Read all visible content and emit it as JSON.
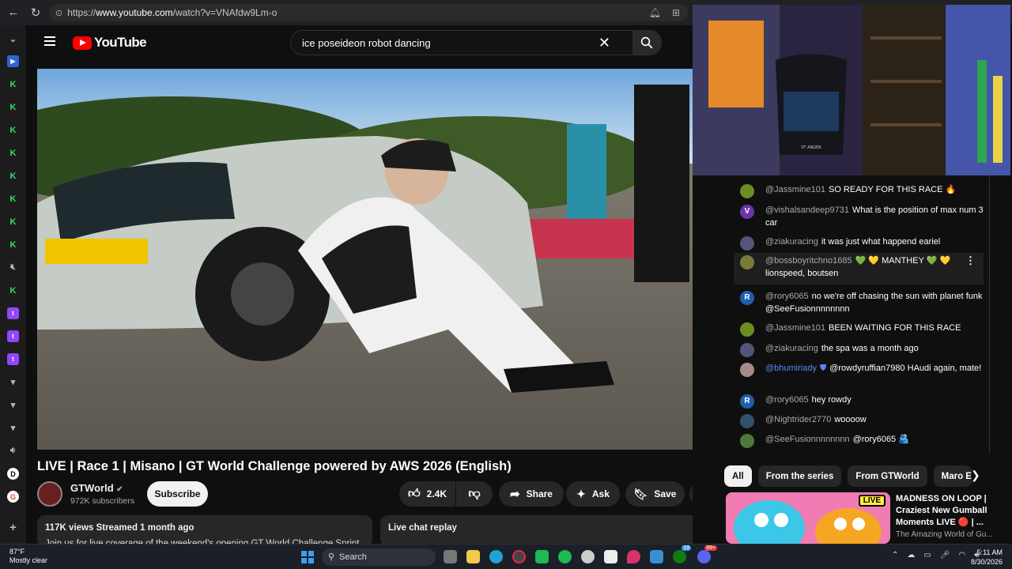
{
  "browser": {
    "url_prefix": "https://",
    "url_host": "www.youtube.com",
    "url_path": "/watch?v=VNAfdw9Lm-o"
  },
  "header": {
    "logo": "YouTube",
    "search_value": "ice poseideon robot dancing"
  },
  "video": {
    "title": "LIVE | Race 1 | Misano | GT World Challenge powered by AWS 2026 (English)",
    "channel": "GTWorld",
    "subscribers": "972K subscribers",
    "subscribe_label": "Subscribe",
    "likes": "2.4K",
    "share_label": "Share",
    "ask_label": "Ask",
    "save_label": "Save"
  },
  "description": {
    "stats": "117K views  Streamed 1 month ago",
    "snippet": "Join us for live coverage of the weekend's opening GT World Challenge Sprint"
  },
  "chat_replay_label": "Live chat replay",
  "chat": [
    {
      "user": "@Jassmine101",
      "text": "SO READY FOR THIS RACE 🔥",
      "avatar_color": "#6b8e23",
      "initial": ""
    },
    {
      "user": "@vishalsandeep9731",
      "text": "What is the position of max num 3 car",
      "avatar_color": "#6b35a8",
      "initial": "V"
    },
    {
      "user": "@ziakuracing",
      "text": "it was just what happend eariel",
      "avatar_color": "#55557a",
      "initial": ""
    },
    {
      "user": "@bossboyritchno1685",
      "text": "💚 💛 MANTHEY 💚 💛 lionspeed, boutsen",
      "avatar_color": "#7a7a3a",
      "initial": ""
    },
    {
      "user": "@rory6065",
      "text": "no we're off chasing the sun with planet funk @SeeFusionnnnnnnn",
      "avatar_color": "#1f5fad",
      "initial": "R"
    },
    {
      "user": "@Jassmine101",
      "text": "BEEN WAITING FOR THIS RACE",
      "avatar_color": "#6b8e23",
      "initial": ""
    },
    {
      "user": "@ziakuracing",
      "text": "the spa was a month ago",
      "avatar_color": "#55557a",
      "initial": ""
    },
    {
      "user": "@bhumiriady",
      "text": "@rowdyruffian7980 HAudi again, mate!",
      "avatar_color": "#a48a8a",
      "initial": ""
    },
    {
      "user": "@rory6065",
      "text": "hey rowdy",
      "avatar_color": "#1f5fad",
      "initial": "R"
    },
    {
      "user": "@Nightrider2770",
      "text": "woooow",
      "avatar_color": "#33506b",
      "initial": ""
    },
    {
      "user": "@SeeFusionnnnnnnn",
      "text": "@rory6065 🫂",
      "avatar_color": "#4b7a3a",
      "initial": ""
    }
  ],
  "chips": [
    "All",
    "From the series",
    "From GTWorld",
    "Maro Er"
  ],
  "recommendation": {
    "title": "MADNESS ON LOOP | Craziest New Gumball Moments LIVE 🔴 | ...",
    "channel": "The Amazing World of Gu...",
    "badge": "LIVE"
  },
  "taskbar": {
    "temp": "87°F",
    "weather": "Mostly clear",
    "search": "Search",
    "time": "5:11 AM",
    "date": "8/30/2026",
    "badge_xbox": "19",
    "badge_discord": "99+"
  },
  "webcam": {
    "chair_text": "ST ANGER"
  }
}
